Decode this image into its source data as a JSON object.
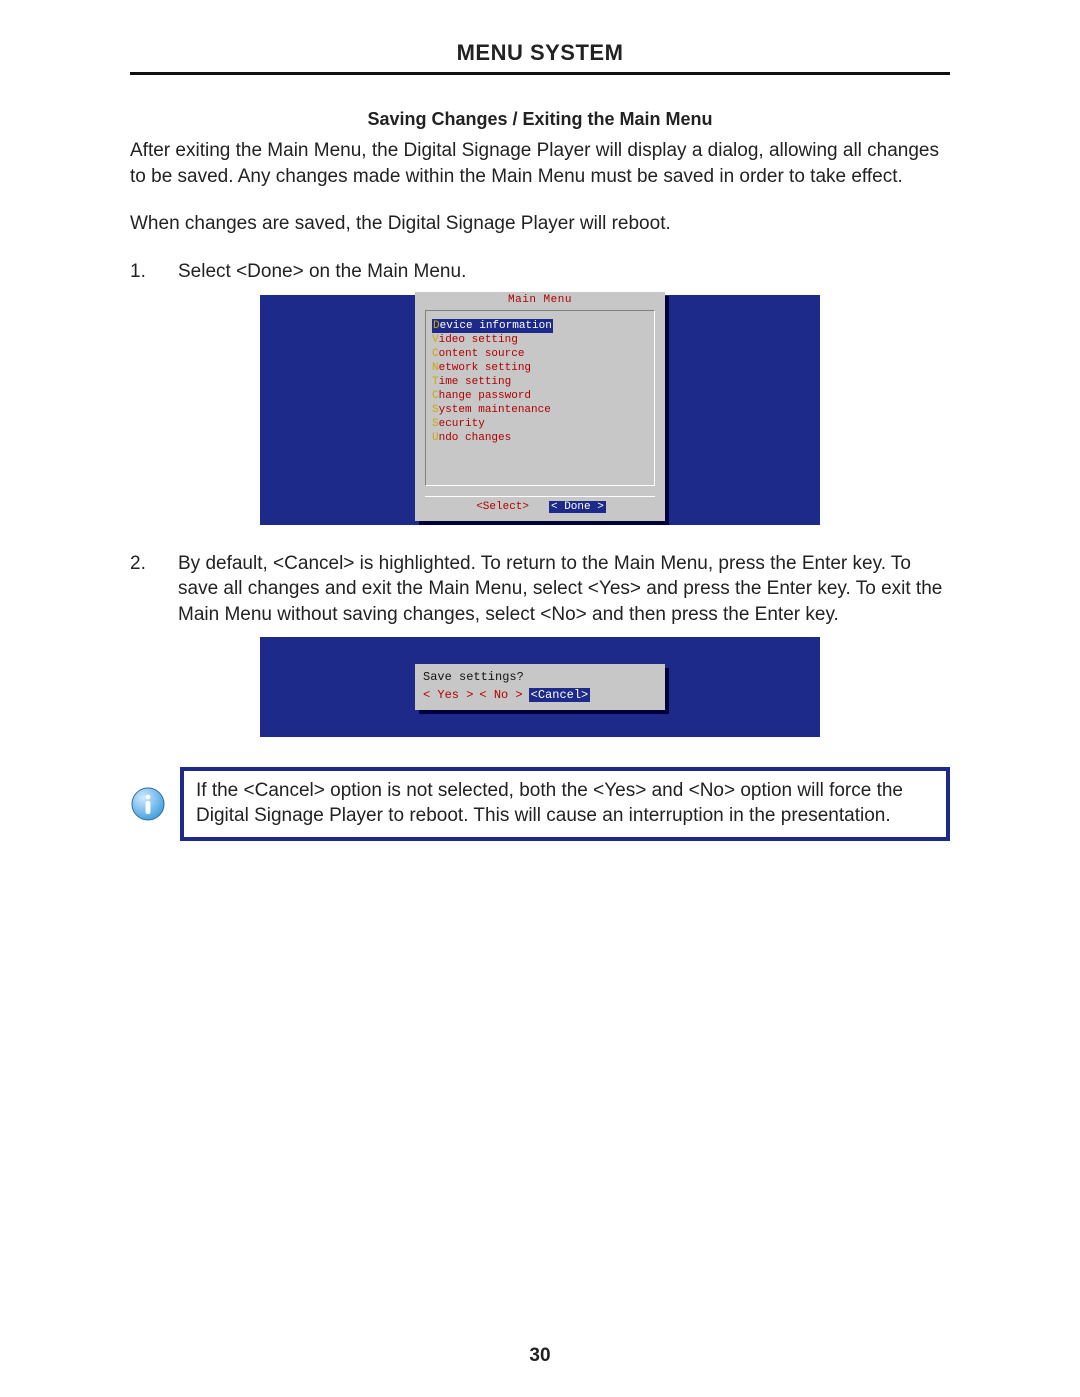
{
  "header": {
    "title": "MENU SYSTEM"
  },
  "section": {
    "title": "Saving Changes / Exiting the Main Menu"
  },
  "intro": {
    "p1": "After exiting the Main Menu, the Digital Signage Player will display a dialog, allowing all changes to be saved.  Any changes made within the Main Menu must be saved in order to take effect.",
    "p2": "When changes are saved, the Digital Signage Player will reboot."
  },
  "steps": {
    "s1": {
      "num": "1.",
      "text": "Select <Done> on the Main Menu."
    },
    "s2": {
      "num": "2.",
      "text": "By default, <Cancel> is highlighted.  To return to the Main Menu, press the Enter key.  To save all changes and exit the Main Menu, select <Yes> and press the Enter key.  To exit the Main Menu without saving changes, select <No> and then press the Enter key."
    }
  },
  "main_menu": {
    "title": "Main Menu",
    "items": [
      {
        "hot": "D",
        "rest": "evice information",
        "selected": true
      },
      {
        "hot": "V",
        "rest": "ideo setting",
        "selected": false
      },
      {
        "hot": "C",
        "rest": "ontent source",
        "selected": false
      },
      {
        "hot": "N",
        "rest": "etwork setting",
        "selected": false
      },
      {
        "hot": "T",
        "rest": "ime setting",
        "selected": false
      },
      {
        "hot": "C",
        "rest": "hange password",
        "selected": false
      },
      {
        "hot": "S",
        "rest": "ystem maintenance",
        "selected": false
      },
      {
        "hot": "S",
        "rest": "ecurity",
        "selected": false
      },
      {
        "hot": "U",
        "rest": "ndo changes",
        "selected": false
      }
    ],
    "buttons": {
      "select": "<Select>",
      "done": "< Done >"
    }
  },
  "save_dialog": {
    "question": "Save settings?",
    "yes": "< Yes  >",
    "no": "<  No  >",
    "cancel": "<Cancel>"
  },
  "callout": {
    "text": "If the <Cancel> option is not selected, both the <Yes> and <No> option will force the Digital Signage Player to reboot.  This will cause an interruption in the presentation."
  },
  "page_number": "30"
}
